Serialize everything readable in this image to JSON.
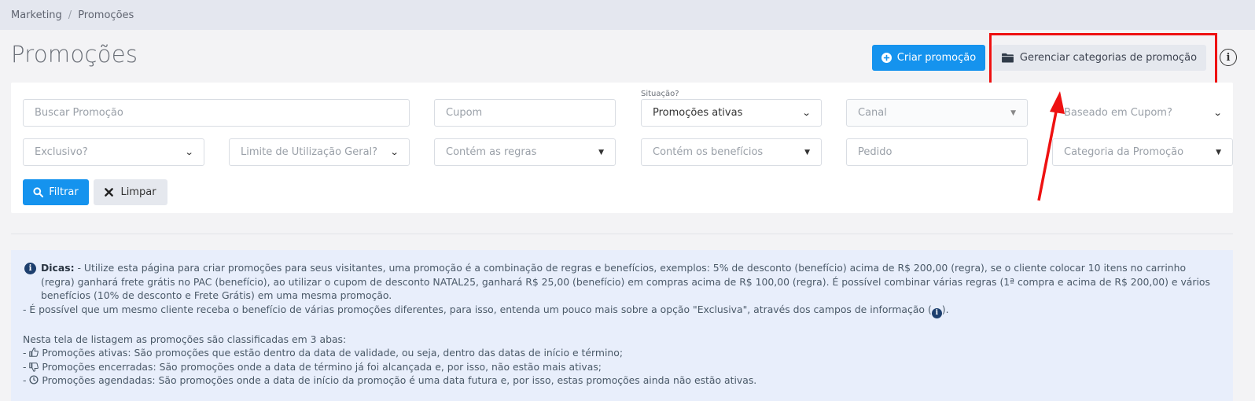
{
  "breadcrumb": {
    "items": [
      "Marketing",
      "Promoções"
    ],
    "separator": "/"
  },
  "header": {
    "title": "Promoções",
    "create_label": "Criar promoção",
    "manage_categories_label": "Gerenciar categorias de promoção",
    "info_symbol": "i"
  },
  "filters": {
    "search_placeholder": "Buscar Promoção",
    "coupon_placeholder": "Cupom",
    "status_label": "Situação?",
    "status_value": "Promoções ativas",
    "channel_placeholder": "Canal",
    "coupon_based_placeholder": "Baseado em Cupom?",
    "exclusive_placeholder": "Exclusivo?",
    "usage_limit_placeholder": "Limite de Utilização Geral?",
    "rules_placeholder": "Contém as regras",
    "benefits_placeholder": "Contém os benefícios",
    "order_placeholder": "Pedido",
    "category_placeholder": "Categoria da Promoção",
    "filter_button": "Filtrar",
    "clear_button": "Limpar"
  },
  "tips": {
    "title": "Dicas:",
    "para1": " - Utilize esta página para criar promoções para seus visitantes, uma promoção é a combinação de regras e benefícios, exemplos: 5% de desconto (benefício) acima de R$ 200,00 (regra), se o cliente colocar 10 itens no carrinho (regra) ganhará frete grátis no PAC (benefício), ao utilizar o cupom de desconto NATAL25, ganhará R$ 25,00 (benefício) em compras acima de R$ 100,00 (regra). É possível combinar várias regras (1ª compra e acima de R$ 200,00) e vários benefícios (10% de desconto e Frete Grátis) em uma mesma promoção.",
    "para2_before": "- É possível que um mesmo cliente receba o benefício de várias promoções diferentes, para isso, entenda um pouco mais sobre a opção \"Exclusiva\", através dos campos de informação (",
    "para2_after": ").",
    "list_intro": "Nesta tela de listagem as promoções são classificadas em 3 abas:",
    "items": [
      "Promoções ativas: São promoções que estão dentro da data de validade, ou seja, dentro das datas de início e término;",
      "Promoções encerradas: São promoções onde a data de término já foi alcançada e, por isso, não estão mais ativas;",
      "Promoções agendadas: São promoções onde a data de início da promoção é uma data futura e, por isso, estas promoções ainda não estão ativas."
    ],
    "item_icons": [
      "thumbs-up-icon",
      "thumbs-down-icon",
      "clock-icon"
    ]
  },
  "colors": {
    "primary": "#1593ee",
    "highlight": "#ee1111",
    "tips_bg": "#e8eefb"
  }
}
